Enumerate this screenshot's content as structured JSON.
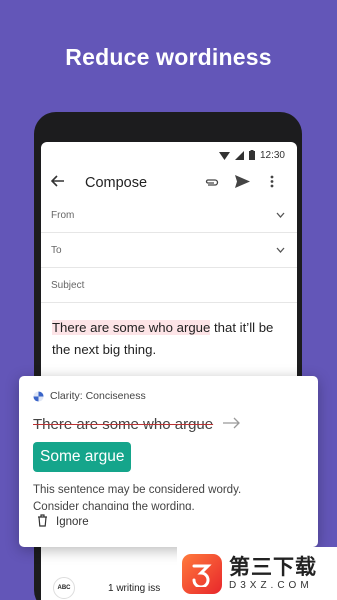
{
  "headline": "Reduce wordiness",
  "status": {
    "time": "12:30"
  },
  "appbar": {
    "title": "Compose"
  },
  "fields": {
    "from": "From",
    "to": "To",
    "subject": "Subject"
  },
  "body": {
    "highlight": "There are some who argue",
    "rest1": " that it’ll be",
    "rest2": "the next big thing."
  },
  "card": {
    "category": "Clarity: Conciseness",
    "original": "There are some who argue",
    "suggestion": "Some argue",
    "desc1": "This sentence may be considered wordy.",
    "desc2": "Consider changing the wording.",
    "ignore": "Ignore"
  },
  "bottombar": {
    "abc": "ABC",
    "status": "1 writing iss"
  },
  "watermark": {
    "cn": "第三下载",
    "en": "D3XZ.COM"
  },
  "colors": {
    "background": "#6356b8",
    "highlight": "#fde4e7",
    "suggestion": "#15a58b"
  }
}
